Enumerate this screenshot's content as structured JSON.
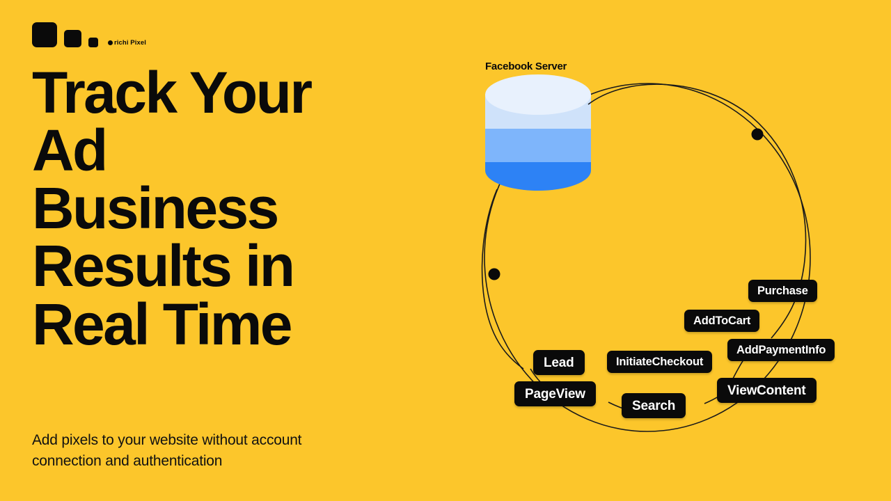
{
  "background_color": "#FCC62B",
  "brand": {
    "name": "richi Pixel",
    "logo_shapes": [
      "square-large",
      "square-medium",
      "square-small"
    ],
    "dot_icon": "bullet-dot-icon"
  },
  "hero": {
    "headline_lines": [
      "Track Your",
      "Ad",
      "Business",
      "Results in",
      "Real Time"
    ],
    "headline_full": "Track Your Ad Business Results in Real Time",
    "subtitle_lines": [
      "Add pixels to your website without account",
      "connection and authentication"
    ],
    "subtitle_full": "Add pixels to your website without account connection and authentication",
    "text_color": "#0A0A0A"
  },
  "diagram": {
    "server_label": "Facebook Server",
    "server_colors": {
      "top_ellipse": "#E8F1FD",
      "band_light": "#CFE2FA",
      "band_medium": "#7EB5FB",
      "band_dark": "#2D82F5"
    },
    "orbit": {
      "stroke": "#1A1A1A",
      "node_color": "#0A0A0A",
      "node_count": 2
    },
    "events": [
      {
        "label": "Purchase",
        "size": "sm"
      },
      {
        "label": "AddToCart",
        "size": "sm"
      },
      {
        "label": "AddPaymentInfo",
        "size": "sm"
      },
      {
        "label": "InitiateCheckout",
        "size": "sm"
      },
      {
        "label": "ViewContent",
        "size": "lg"
      },
      {
        "label": "Lead",
        "size": "lg"
      },
      {
        "label": "PageView",
        "size": "lg"
      },
      {
        "label": "Search",
        "size": "lg"
      }
    ],
    "tag_colors": {
      "background": "#0A0A0A",
      "text": "#FFFFFF"
    }
  }
}
